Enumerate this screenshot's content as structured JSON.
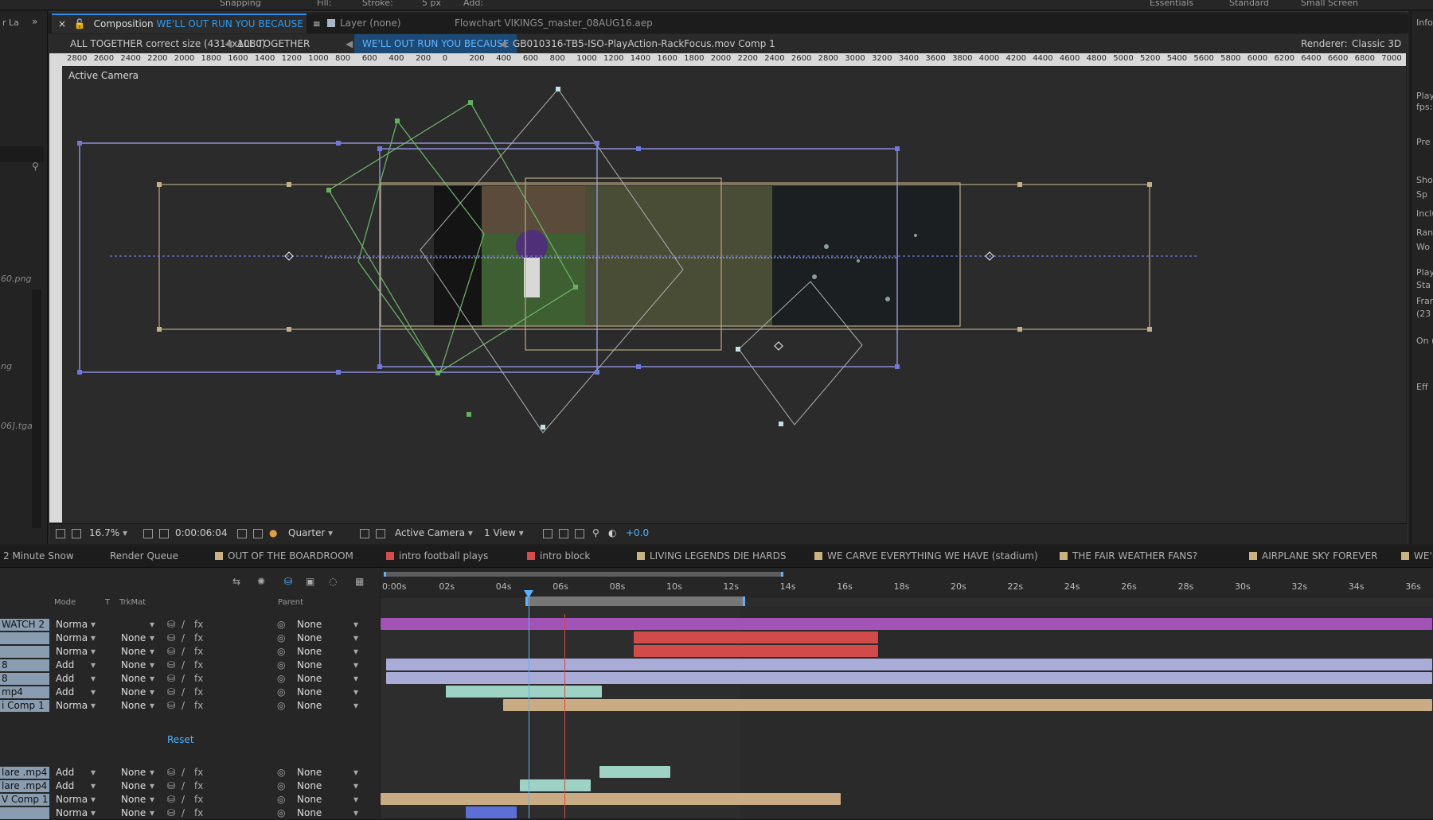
{
  "topbar": {
    "snapping": "Snapping",
    "fill": "Fill:",
    "stroke": "Stroke:",
    "px": "5 px",
    "add": "Add:",
    "workspaces": [
      "Essentials",
      "Standard",
      "Small Screen"
    ]
  },
  "left_panel": {
    "tab": "r La",
    "files": [
      "60.png",
      "ng",
      "06].tga"
    ]
  },
  "right_panel": {
    "labels": [
      "Info",
      "Play",
      "fps:",
      "Pre",
      "Sho",
      "Sp",
      "Inclu",
      "Ran",
      "Wo",
      "Play",
      "Sta",
      "Fran",
      "(23",
      "On (",
      "Eff"
    ]
  },
  "comp_tabs": [
    {
      "prefix": "Composition",
      "highlight": "WE'LL OUT RUN YOU BECAUSE",
      "active": true
    },
    {
      "label": "Layer (none)"
    },
    {
      "label": "Flowchart VIKINGS_master_08AUG16.aep"
    }
  ],
  "breadcrumbs": [
    "ALL TOGETHER correct size (4314x1080)",
    "ALL TOGETHER",
    "WE'LL OUT RUN YOU BECAUSE",
    "GB010316-TB5-ISO-PlayAction-RackFocus.mov Comp 1"
  ],
  "renderer": {
    "label": "Renderer:",
    "value": "Classic 3D"
  },
  "ruler": [
    "2800",
    "2600",
    "2400",
    "2200",
    "2000",
    "1800",
    "1600",
    "1400",
    "1200",
    "1000",
    "800",
    "600",
    "400",
    "200",
    "0",
    "200",
    "400",
    "600",
    "800",
    "1000",
    "1200",
    "1400",
    "1600",
    "1800",
    "2000",
    "2200",
    "2400",
    "2600",
    "2800",
    "3000",
    "3200",
    "3400",
    "3600",
    "3800",
    "4000",
    "4200",
    "4400",
    "4600",
    "4800",
    "5000",
    "5200",
    "5400",
    "5600",
    "5800",
    "6000",
    "6200",
    "6400",
    "6600",
    "6800",
    "7000"
  ],
  "viewer": {
    "camera_label": "Active Camera"
  },
  "viewer_toolbar": {
    "zoom": "16.7%",
    "timecode": "0:00:06:04",
    "resolution": "Quarter",
    "view": "Active Camera",
    "layout": "1 View",
    "exposure": "+0.0"
  },
  "timeline_tabs": [
    "2 Minute Snow",
    "Render Queue",
    "OUT OF THE BOARDROOM",
    "intro football plays",
    "intro block",
    "LIVING LEGENDS DIE HARDS",
    "WE CARVE EVERYTHING WE HAVE (stadium)",
    "THE FAIR WEATHER FANS?",
    "AIRPLANE SKY FOREVER",
    "WE'LL"
  ],
  "timeline_tab_colors": [
    "",
    "",
    "#c9b37e",
    "#d64b4b",
    "#d64b4b",
    "#c9b37e",
    "#c9b37e",
    "#c9b37e",
    "#c9b37e",
    "#c9b37e"
  ],
  "columns": {
    "mode": "Mode",
    "t": "T",
    "trkmat": "TrkMat",
    "parent": "Parent"
  },
  "time_ticks": [
    "0:00s",
    "02s",
    "04s",
    "06s",
    "08s",
    "10s",
    "12s",
    "14s",
    "16s",
    "18s",
    "20s",
    "22s",
    "24s",
    "26s",
    "28s",
    "30s",
    "32s",
    "34s",
    "36s"
  ],
  "layers": [
    {
      "name": "WATCH 2",
      "mode": "Norma",
      "trkmat": "",
      "parent": "None"
    },
    {
      "name": "",
      "mode": "Norma",
      "trkmat": "None",
      "parent": "None"
    },
    {
      "name": "",
      "mode": "Norma",
      "trkmat": "None",
      "parent": "None"
    },
    {
      "name": "8",
      "mode": "Add",
      "trkmat": "None",
      "parent": "None"
    },
    {
      "name": "8",
      "mode": "Add",
      "trkmat": "None",
      "parent": "None"
    },
    {
      "name": "mp4",
      "mode": "Add",
      "trkmat": "None",
      "parent": "None"
    },
    {
      "name": "i Comp 1",
      "mode": "Norma",
      "trkmat": "None",
      "parent": "None"
    },
    {
      "name": "lare .mp4",
      "mode": "Add",
      "trkmat": "None",
      "parent": "None"
    },
    {
      "name": "lare .mp4",
      "mode": "Add",
      "trkmat": "None",
      "parent": "None"
    },
    {
      "name": "V Comp 1",
      "mode": "Norma",
      "trkmat": "None",
      "parent": "None"
    },
    {
      "name": "",
      "mode": "Norma",
      "trkmat": "None",
      "parent": "None"
    }
  ],
  "reset_label": "Reset",
  "colors": {
    "accent": "#2d8ceb",
    "purple": "#a353b5",
    "red": "#d14b4b",
    "lavender": "#a8acd6",
    "teal": "#9ed2c5",
    "tan": "#c9ac84",
    "blue": "#5b6fd6"
  }
}
